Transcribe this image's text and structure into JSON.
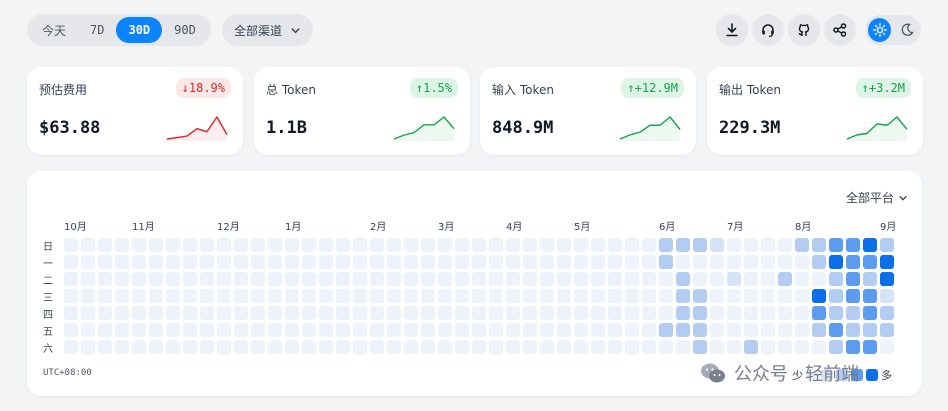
{
  "ranges": [
    {
      "label": "今天",
      "active": false
    },
    {
      "label": "7D",
      "active": false
    },
    {
      "label": "30D",
      "active": true
    },
    {
      "label": "90D",
      "active": false
    }
  ],
  "channel_select": {
    "label": "全部渠道"
  },
  "toolbar_icons": [
    "download-icon",
    "headset-icon",
    "github-icon",
    "share-icon"
  ],
  "theme": {
    "active": "light"
  },
  "cards": [
    {
      "label": "预估费用",
      "delta": "18.9%",
      "direction": "down",
      "value": "$63.88",
      "trend": [
        3,
        4,
        5,
        10,
        8,
        18,
        6
      ],
      "color": "#dc2626"
    },
    {
      "label": "总 Token",
      "delta": "1.5%",
      "direction": "up",
      "value": "1.1B",
      "trend": [
        2,
        5,
        7,
        13,
        13,
        19,
        10
      ],
      "color": "#16a34a"
    },
    {
      "label": "输入 Token",
      "delta": "+12.9M",
      "direction": "up",
      "value": "848.9M",
      "trend": [
        2,
        5,
        7,
        12,
        12,
        18,
        9
      ],
      "color": "#16a34a"
    },
    {
      "label": "输出 Token",
      "delta": "+3.2M",
      "direction": "up",
      "value": "229.3M",
      "trend": [
        2,
        5,
        6,
        13,
        12,
        18,
        9
      ],
      "color": "#16a34a"
    }
  ],
  "heatmap": {
    "platform_select": "全部平台",
    "months": [
      {
        "label": "10月",
        "col": 0
      },
      {
        "label": "11月",
        "col": 4
      },
      {
        "label": "12月",
        "col": 9
      },
      {
        "label": "1月",
        "col": 13
      },
      {
        "label": "2月",
        "col": 18
      },
      {
        "label": "3月",
        "col": 22
      },
      {
        "label": "4月",
        "col": 26
      },
      {
        "label": "5月",
        "col": 30
      },
      {
        "label": "6月",
        "col": 35
      },
      {
        "label": "7月",
        "col": 39
      },
      {
        "label": "8月",
        "col": 43
      },
      {
        "label": "9月",
        "col": 48
      }
    ],
    "days": [
      "日",
      "一",
      "二",
      "三",
      "四",
      "五",
      "六"
    ],
    "levels": [
      "0000000000000000000000000000000000022210000223342",
      "0000000000000000000000000000000000020000000024334",
      "0000000000000000000000000000000000002001002002324",
      "0000000000000000000000000000000000002200000042331",
      "0000000000000000000000000000000000002200000032232",
      "0000000000000000000000000000000000022200000023222",
      "0000000000000000000000000000000000000200200002330"
    ],
    "palette": [
      "#eef3fb",
      "#d6e4f7",
      "#b3cdf2",
      "#5b9cf0",
      "#0a6fe8"
    ],
    "timezone": "UTC+08:00",
    "legend": {
      "less": "少",
      "more": "多"
    }
  },
  "watermark": {
    "text": "公众号 · 轻前端"
  }
}
